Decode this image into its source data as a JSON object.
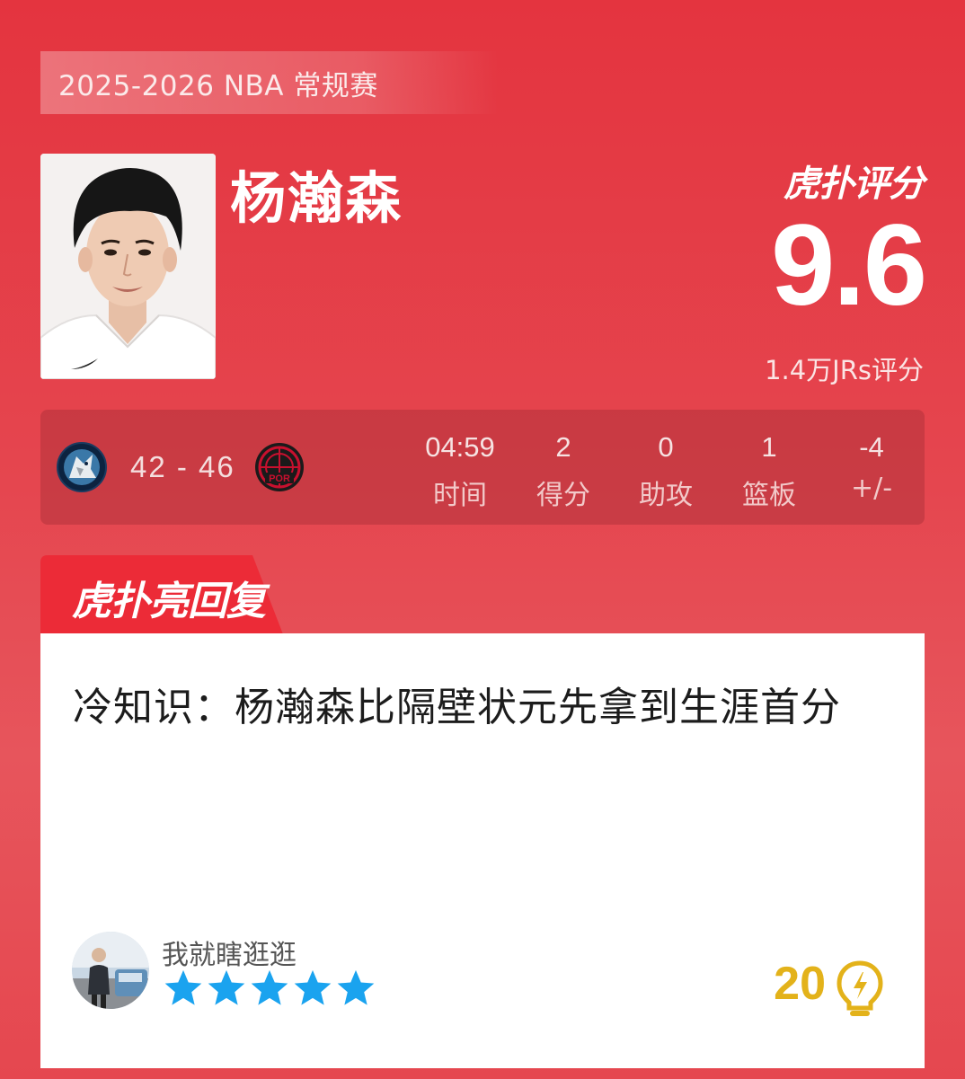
{
  "season_label": "2025-2026 NBA 常规赛",
  "player": {
    "name": "杨瀚森"
  },
  "rating": {
    "brand": "虎扑评分",
    "score": "9.6",
    "votes": "1.4万JRs评分"
  },
  "game": {
    "home_team_icon": "timberwolves-logo",
    "away_team_icon": "blazers-logo",
    "away_team_abbr": "POR",
    "score": "42 - 46",
    "stats": [
      {
        "value": "04:59",
        "label": "时间"
      },
      {
        "value": "2",
        "label": "得分"
      },
      {
        "value": "0",
        "label": "助攻"
      },
      {
        "value": "1",
        "label": "篮板"
      },
      {
        "value": "-4",
        "label": "+/-"
      }
    ]
  },
  "reply": {
    "tab_label": "虎扑亮回复",
    "text": "冷知识：杨瀚森比隔壁状元先拿到生涯首分",
    "username": "我就瞎逛逛",
    "stars": 5,
    "likes": "20"
  },
  "colors": {
    "background": "#e4343f",
    "tab": "#ec2b37",
    "star": "#1aa3ef",
    "likes": "#e3b21a"
  }
}
